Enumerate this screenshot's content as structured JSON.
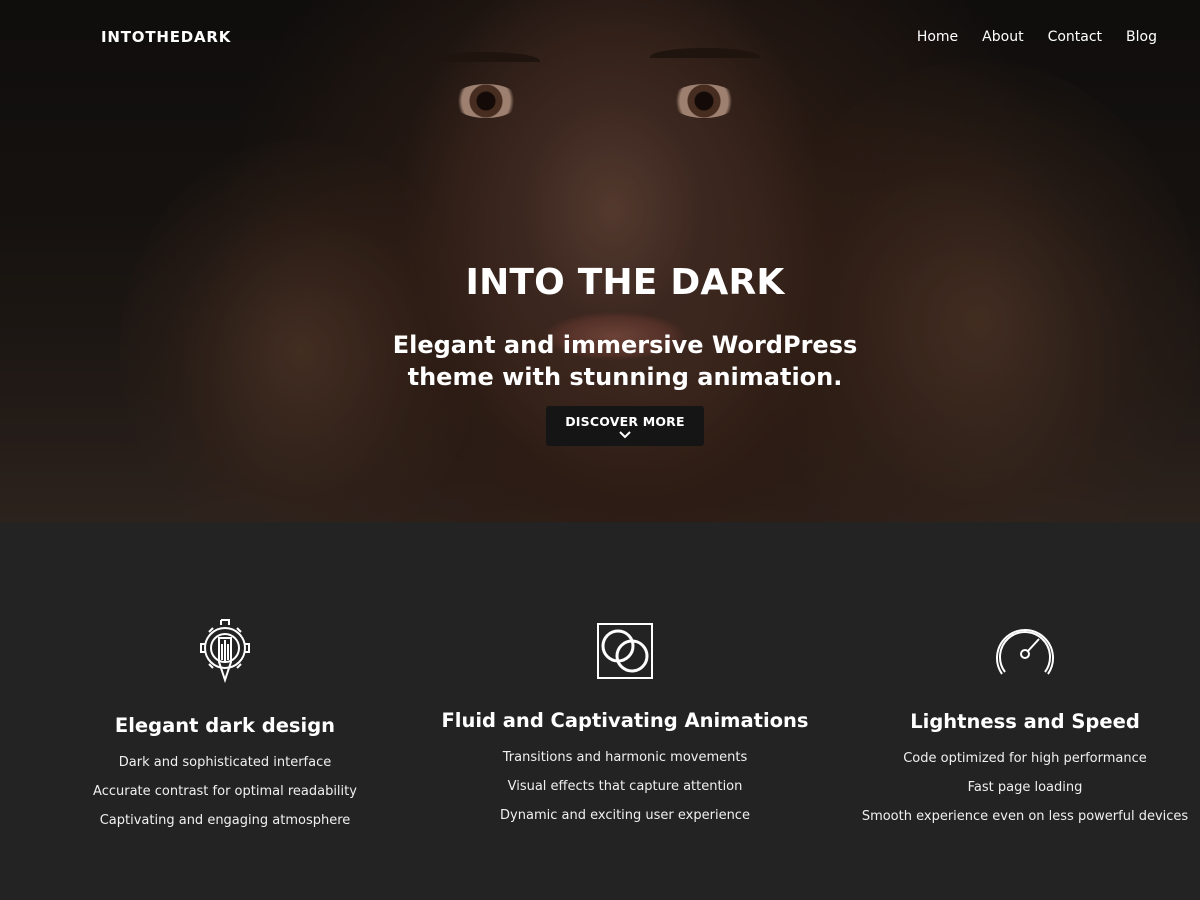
{
  "header": {
    "brand": "INTOTHEDARK",
    "nav": [
      "Home",
      "About",
      "Contact",
      "Blog"
    ]
  },
  "hero": {
    "title": "INTO THE DARK",
    "subtitle": "Elegant and immersive WordPress theme with stunning animation.",
    "cta_label": "DISCOVER MORE"
  },
  "features": [
    {
      "icon": "gear-pen-icon",
      "title": "Elegant dark design",
      "items": [
        "Dark and sophisticated interface",
        "Accurate contrast for optimal readability",
        "Captivating and engaging atmosphere"
      ]
    },
    {
      "icon": "overlapping-circles-icon",
      "title": "Fluid and Captivating Animations",
      "items": [
        "Transitions and harmonic movements",
        "Visual effects that capture attention",
        "Dynamic and exciting user experience"
      ]
    },
    {
      "icon": "speedometer-icon",
      "title": "Lightness and Speed",
      "items": [
        "Code optimized for high performance",
        "Fast page loading",
        "Smooth experience even on less powerful devices"
      ]
    }
  ],
  "colors": {
    "page_background": "#232323",
    "button_background": "#151515",
    "text": "#ffffff"
  }
}
